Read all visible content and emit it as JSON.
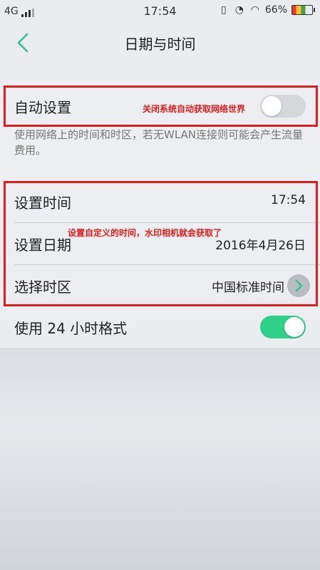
{
  "status_bar": {
    "network": "4G",
    "time": "17:54",
    "battery": "66%",
    "icons": [
      "signal-icon",
      "vibrate-icon",
      "alarm-icon",
      "wifi-icon",
      "battery-icon"
    ]
  },
  "header": {
    "title": "日期与时间"
  },
  "auto": {
    "label": "自动设置",
    "annotation": "关闭系统自动获取网络世界",
    "toggle_state": "off",
    "hint": "使用网络上的时间和时区，若无WLAN连接则可能会产生流量费用。"
  },
  "manual": {
    "annotation": "设置自定义的时间，水印相机就会获取了",
    "rows": [
      {
        "label": "设置时间",
        "value": "17:54"
      },
      {
        "label": "设置日期",
        "value": "2016年4月26日"
      },
      {
        "label": "选择时区",
        "value": "中国标准时间"
      }
    ]
  },
  "format24": {
    "label": "使用 24 小时格式",
    "toggle_state": "on"
  },
  "colors": {
    "accent": "#2fd08a",
    "annotation": "#e01e1e",
    "toggle_off": "#d5d7da"
  }
}
